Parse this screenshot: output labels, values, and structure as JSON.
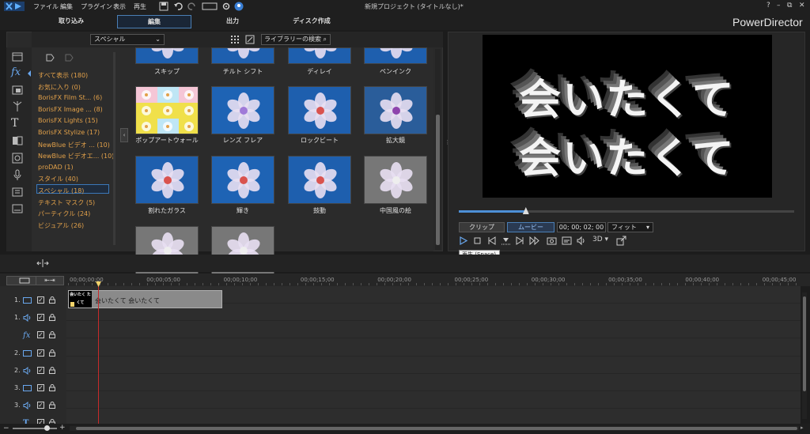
{
  "menu": [
    "ファイル",
    "編集",
    "プラグイン",
    "表示",
    "再生"
  ],
  "doc_title": "新規プロジェクト (タイトルなし)*",
  "window_controls": [
    "?",
    "–",
    "⧉",
    "✕"
  ],
  "modes": [
    "取り込み",
    "編集",
    "出力",
    "ディスク作成"
  ],
  "brand": "PowerDirector",
  "library": {
    "dropdown": "スペシャル",
    "search_placeholder": "ライブラリーの検索",
    "categories": [
      {
        "label": "すべて表示 (180)"
      },
      {
        "label": "お気に入り (0)"
      },
      {
        "label": "BorisFX Film St... (6)"
      },
      {
        "label": "BorisFX Image ... (8)"
      },
      {
        "label": "BorisFX Lights (15)"
      },
      {
        "label": "BorisFX Stylize (17)"
      },
      {
        "label": "NewBlue ビデオ ... (10)"
      },
      {
        "label": "NewBlue ビデオエ... (10)"
      },
      {
        "label": "proDAD (1)"
      },
      {
        "label": "スタイル (40)"
      },
      {
        "label": "スペシャル (18)"
      },
      {
        "label": "テキスト マスク (5)"
      },
      {
        "label": "パーティクル (24)"
      },
      {
        "label": "ビジュアル (26)"
      }
    ],
    "selected_category": "スペシャル (18)",
    "effects": [
      "スキップ",
      "チルト シフト",
      "ディレイ",
      "ペンインク",
      "ポップアートウォール",
      "レンズ フレア",
      "ロックビート",
      "拡大鏡",
      "割れたガラス",
      "輝き",
      "鼓動",
      "中国風の絵"
    ]
  },
  "preview": {
    "video_lines": [
      "会いたくて",
      "会いたくて"
    ],
    "clip_label": "クリップ",
    "movie_label": "ムービー",
    "timecode": "00; 00; 02; 00",
    "fit": "フィット",
    "tooltip": "再生 (Space)",
    "three_d": "3D ▾",
    "seek_position": 0.2
  },
  "timeline": {
    "ruler": [
      "00;00;00;00",
      "00;00;05;00",
      "00;00;10;00",
      "00;00;15;00",
      "00;00;20;00",
      "00;00;25;00",
      "00;00;30;00",
      "00;00;35;00",
      "00;00;40;00",
      "00;00;45;00"
    ],
    "tracks": [
      {
        "num": "1.",
        "type": "video"
      },
      {
        "num": "1.",
        "type": "audio"
      },
      {
        "num": "",
        "type": "fx"
      },
      {
        "num": "2.",
        "type": "video"
      },
      {
        "num": "2.",
        "type": "audio"
      },
      {
        "num": "3.",
        "type": "video"
      },
      {
        "num": "3.",
        "type": "audio"
      },
      {
        "num": "",
        "type": "title"
      }
    ],
    "clip_title": "会いたくて 会いたくて",
    "clip_thumb": "会いたく たくて"
  },
  "colors": {
    "accent": "#4a8ad8",
    "category": "#e2a14a",
    "playhead": "#c72a2a"
  }
}
